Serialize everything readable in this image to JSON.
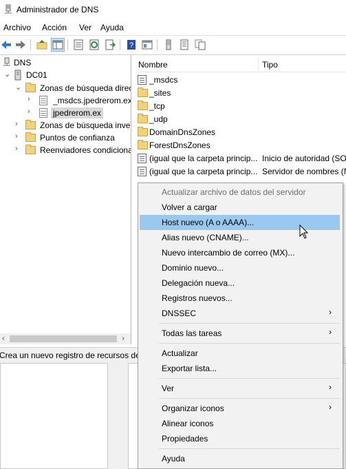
{
  "window": {
    "title": "Administrador de DNS"
  },
  "menubar": [
    "Archivo",
    "Acción",
    "Ver",
    "Ayuda"
  ],
  "tree": {
    "root": "DNS",
    "server": "DC01",
    "forward_zones": "Zonas de búsqueda directa",
    "msdcs_zone": "_msdcs.jpedrerom.ex",
    "zone": "jpedrerom.ex",
    "reverse_zones": "Zonas de búsqueda inversa",
    "trust_points": "Puntos de confianza",
    "forwarders": "Reenviadores condicionales"
  },
  "list": {
    "columns": {
      "name": "Nombre",
      "type": "Tipo"
    },
    "rows": [
      {
        "name": "_msdcs",
        "type": ""
      },
      {
        "name": "_sites",
        "type": ""
      },
      {
        "name": "_tcp",
        "type": ""
      },
      {
        "name": "_udp",
        "type": ""
      },
      {
        "name": "DomainDnsZones",
        "type": ""
      },
      {
        "name": "ForestDnsZones",
        "type": ""
      },
      {
        "name": "(igual que la carpeta princip...",
        "type": "Inicio de autoridad (SOA)"
      },
      {
        "name": "(igual que la carpeta princip...",
        "type": "Servidor de nombres (NS)"
      }
    ]
  },
  "statusbar": {
    "text": "Crea un nuevo registro de recursos de"
  },
  "context_menu": {
    "items": [
      {
        "label": "Actualizar archivo de datos del servidor",
        "disabled": true
      },
      {
        "label": "Volver a cargar"
      },
      {
        "label": "Host nuevo (A o AAAA)...",
        "highlighted": true
      },
      {
        "label": "Alias nuevo (CNAME)..."
      },
      {
        "label": "Nuevo intercambio de correo (MX)..."
      },
      {
        "label": "Dominio nuevo..."
      },
      {
        "label": "Delegación nueva..."
      },
      {
        "label": "Registros nuevos..."
      },
      {
        "label": "DNSSEC",
        "submenu": true
      },
      {
        "label": "Todas las tareas",
        "submenu": true
      },
      {
        "label": "Actualizar"
      },
      {
        "label": "Exportar lista..."
      },
      {
        "label": "Ver",
        "submenu": true
      },
      {
        "label": "Organizar iconos",
        "submenu": true
      },
      {
        "label": "Alinear iconos"
      },
      {
        "label": "Propiedades"
      },
      {
        "label": "Ayuda"
      }
    ]
  },
  "colors": {
    "highlight": "#99c9ef",
    "selected_tree_row": "#d9d9d9"
  }
}
